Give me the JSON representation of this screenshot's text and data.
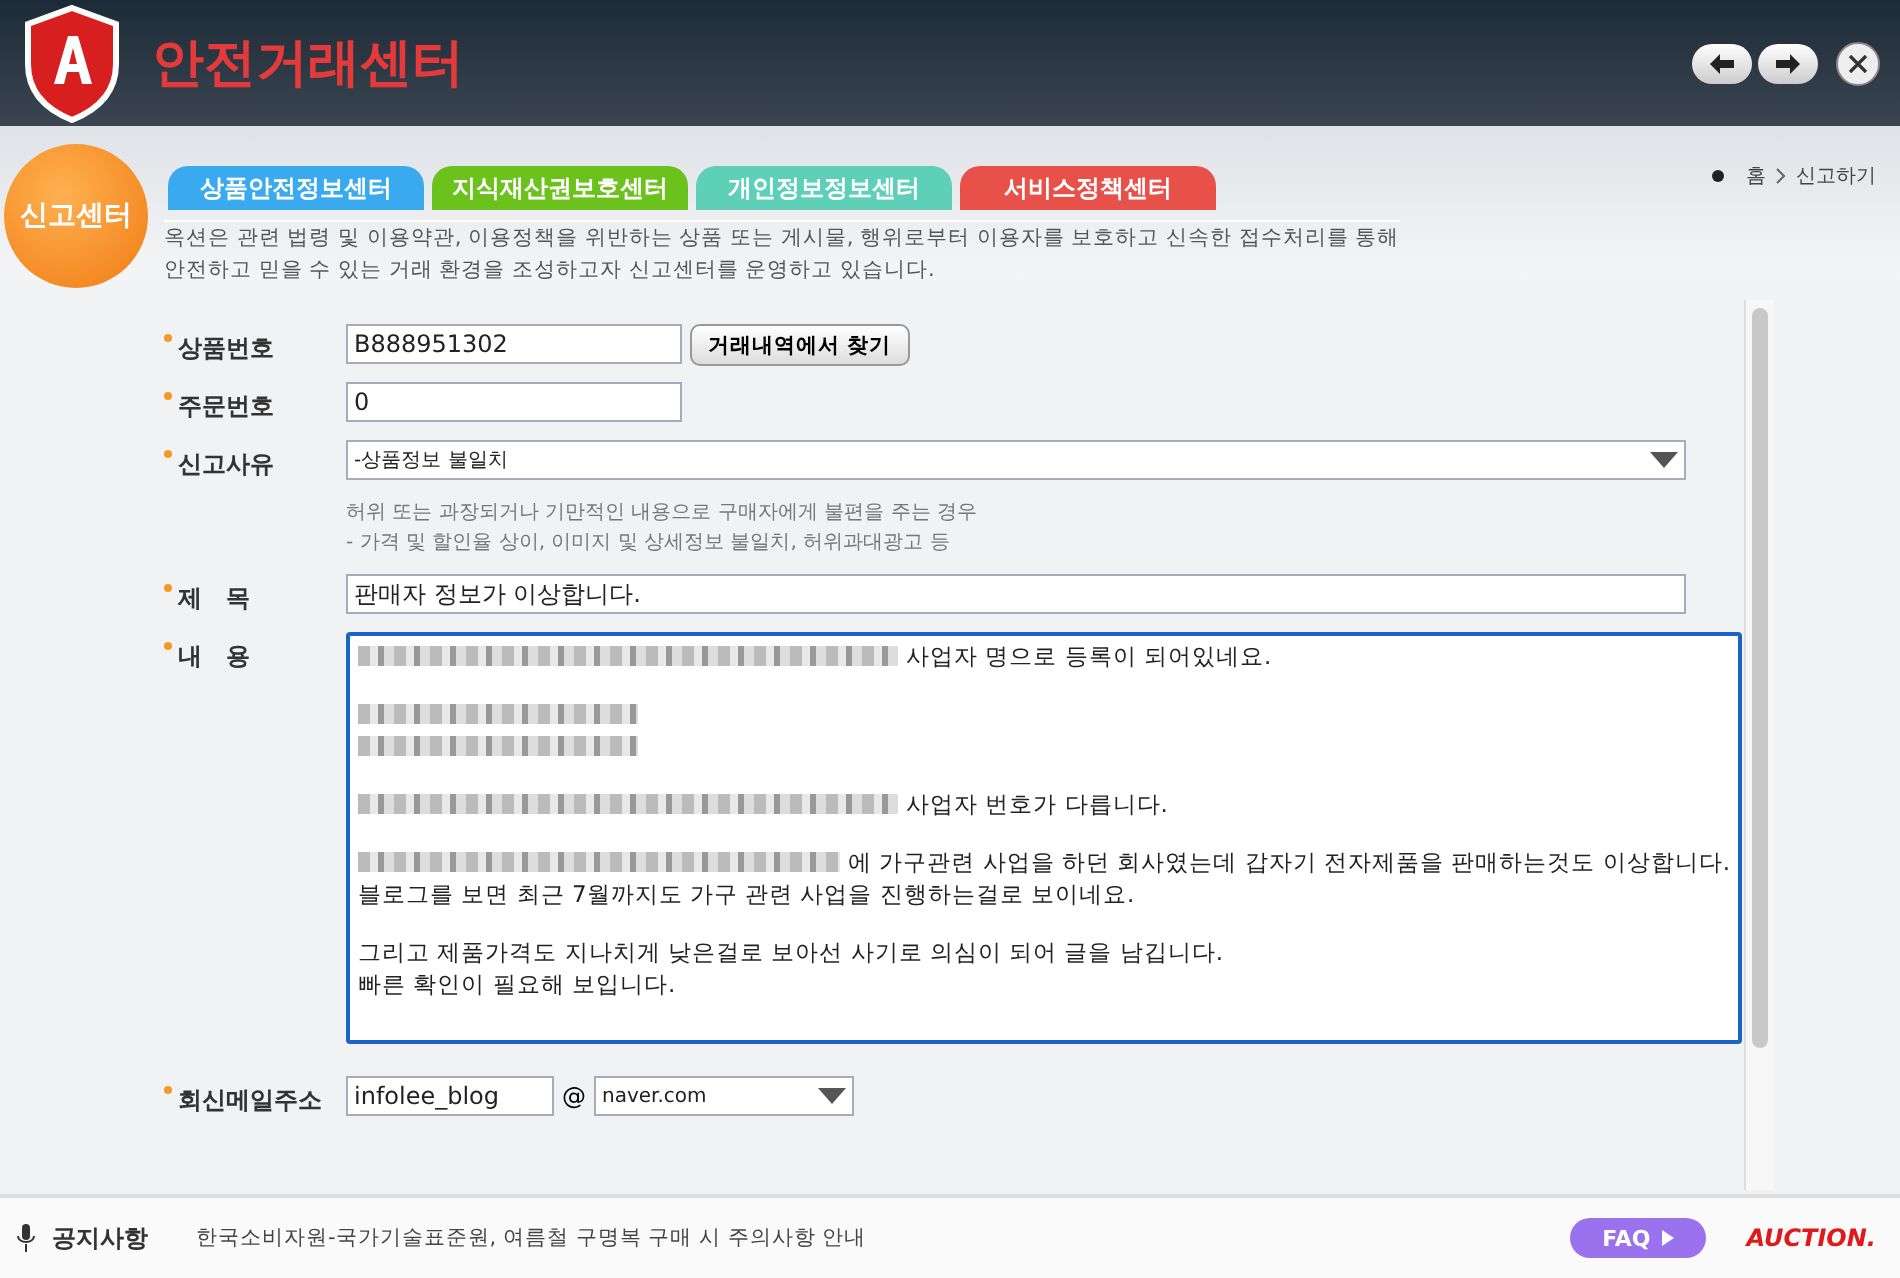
{
  "header": {
    "title": "안전거래센터"
  },
  "badge": "신고센터",
  "tabs": [
    {
      "label": "상품안전정보센터",
      "color": "#3aaaf0",
      "selected": false
    },
    {
      "label": "지식재산권보호센터",
      "color": "#6cc21c",
      "selected": false
    },
    {
      "label": "개인정보정보센터",
      "color": "#5fd0b8",
      "selected": false
    },
    {
      "label": "서비스정책센터",
      "color": "#e8514a",
      "selected": false
    }
  ],
  "breadcrumb": [
    "홈",
    "신고하기"
  ],
  "intro": "옥션은 관련 법령 및 이용약관, 이용정책을 위반하는 상품 또는 게시물, 행위로부터 이용자를 보호하고 신속한 접수처리를 통해\n안전하고 믿을 수 있는 거래 환경을 조성하고자 신고센터를 운영하고 있습니다.",
  "form": {
    "product_no": {
      "label": "상품번호",
      "value": "B888951302",
      "button": "거래내역에서 찾기"
    },
    "order_no": {
      "label": "주문번호",
      "value": "0"
    },
    "reason": {
      "label": "신고사유",
      "value": "-상품정보 불일치",
      "hint": "허위 또는 과장되거나 기만적인 내용으로 구매자에게 불편을 주는 경우\n- 가격 및 할인율 상이, 이미지 및 상세정보 불일치, 허위과대광고 등"
    },
    "subject": {
      "label": "제　목",
      "value": "판매자 정보가 이상합니다."
    },
    "content": {
      "label": "내　용",
      "lines": [
        {
          "text": "사업자 명으로 등록이 되어있네요.",
          "redacted": true,
          "gap_before": false
        },
        {
          "redacted": true,
          "gap_before": true
        },
        {
          "redacted": true,
          "gap_before": false
        },
        {
          "text": "사업자 번호가 다릅니다.",
          "redacted": true,
          "gap_before": true
        },
        {
          "text": "에 가구관련 사업을 하던 회사였는데 갑자기 전자제품을 판매하는것도 이상합니다.",
          "redacted": true,
          "gap_before": true
        },
        {
          "text": "블로그를 보면 최근 7월까지도 가구 관련 사업을 진행하는걸로 보이네요.",
          "redacted": false,
          "gap_before": false
        },
        {
          "text": "그리고 제품가격도 지나치게 낮은걸로 보아선 사기로 의심이 되어 글을 남깁니다.",
          "redacted": false,
          "gap_before": true
        },
        {
          "text": "빠른 확인이 필요해 보입니다.",
          "redacted": false,
          "gap_before": false
        }
      ]
    },
    "email": {
      "label": "회신메일주소",
      "user": "infolee_blog",
      "at": "@",
      "domain": "naver.com"
    }
  },
  "footer": {
    "label": "공지사항",
    "notice": "한국소비자원-국가기술표준원, 여름철 구명복 구매 시 주의사항 안내",
    "faq": "FAQ",
    "brand": "AUCTION."
  }
}
